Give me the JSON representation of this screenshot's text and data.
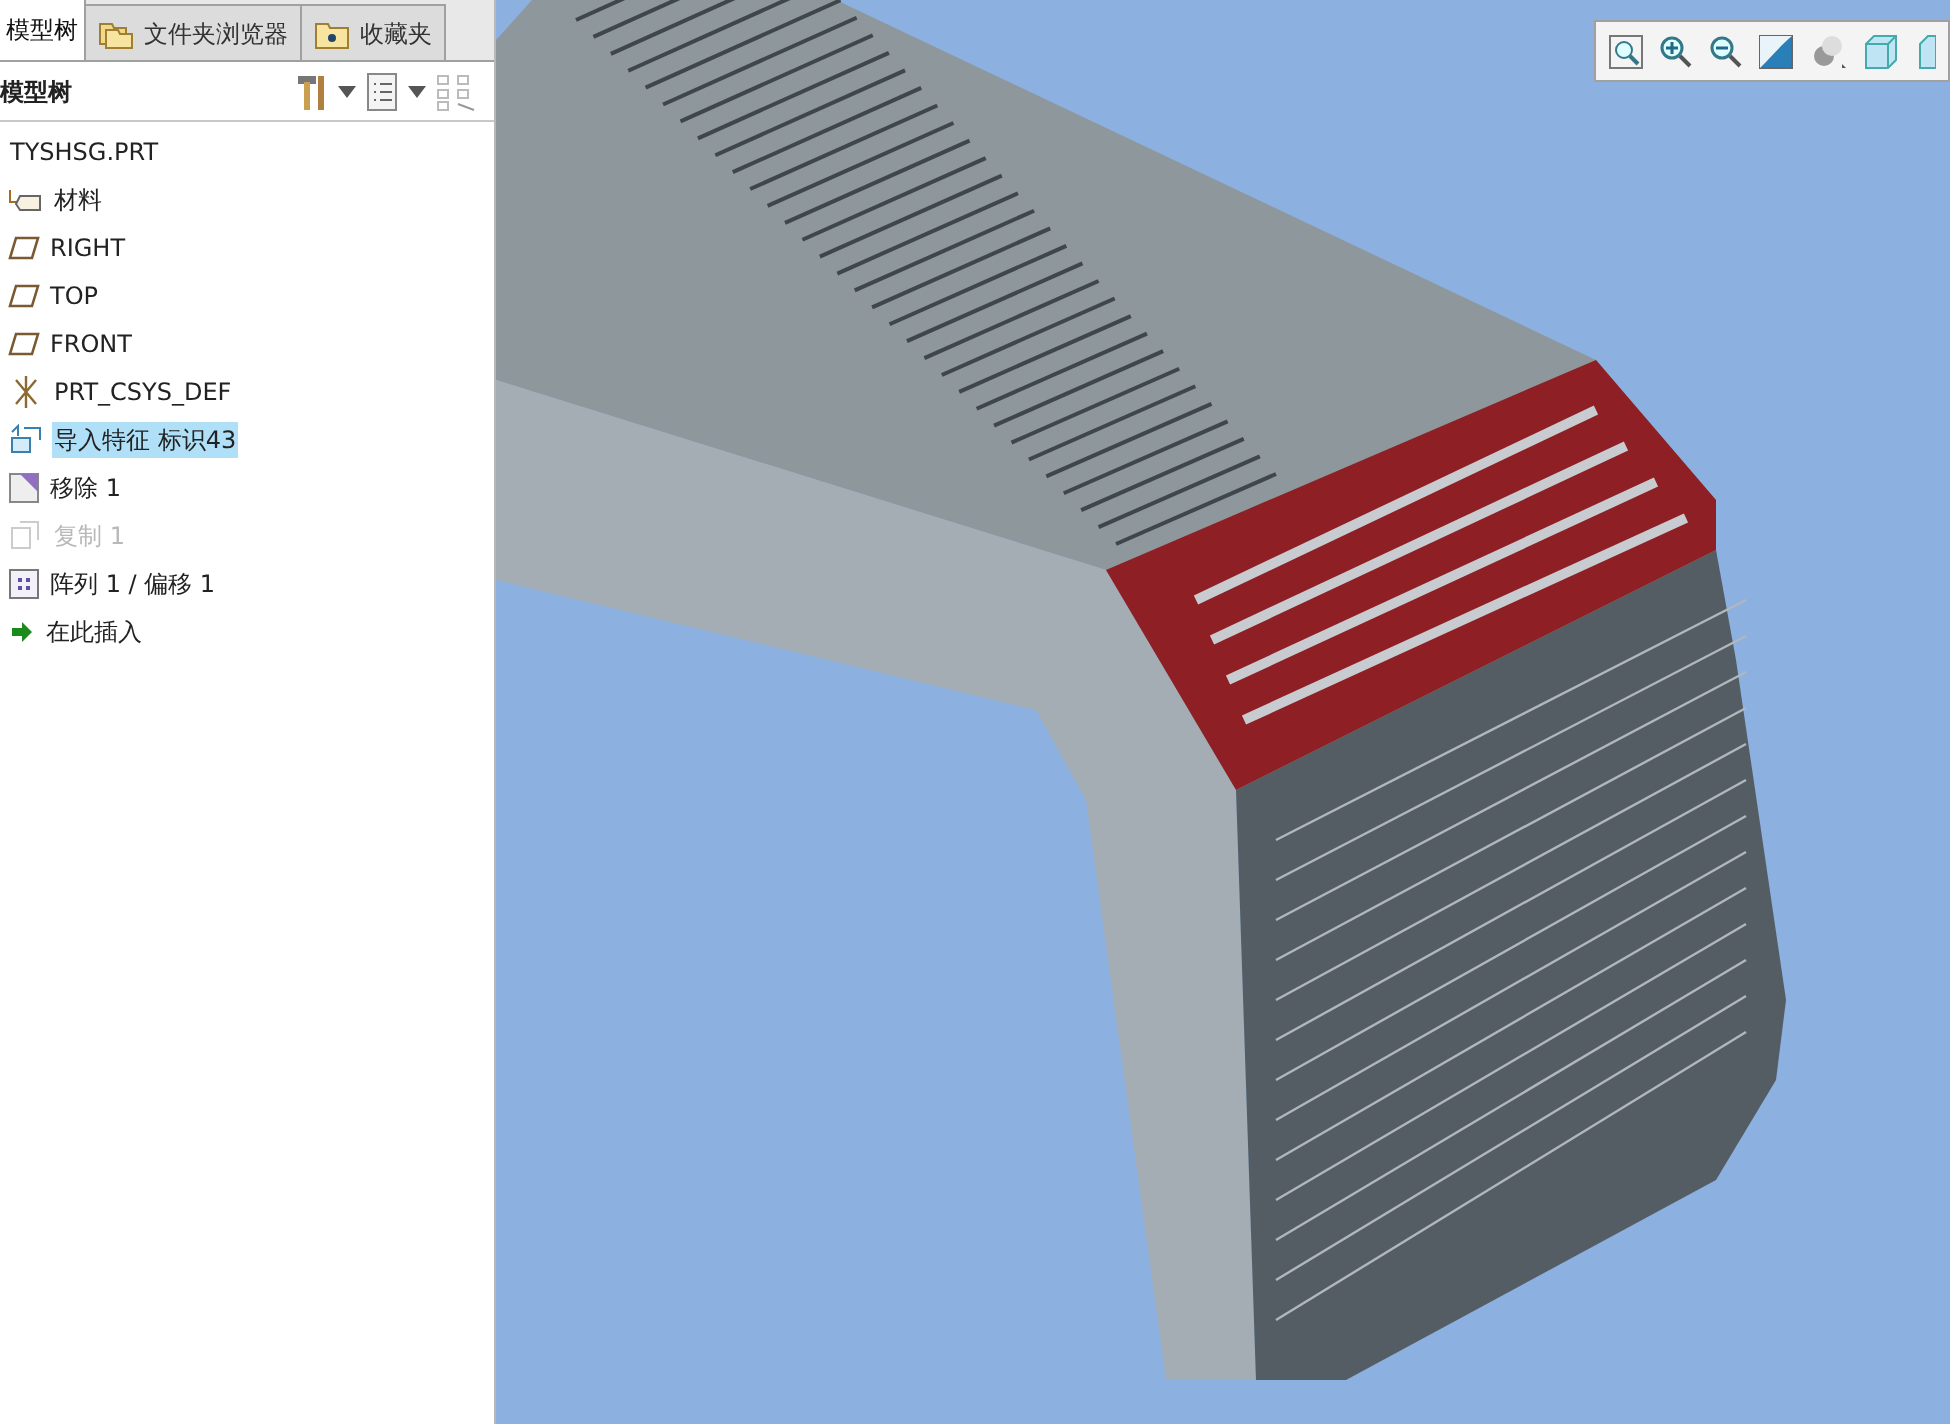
{
  "tabs": [
    {
      "label": "模型树",
      "kind": "tree",
      "selected": true
    },
    {
      "label": "文件夹浏览器",
      "kind": "folders",
      "selected": false
    },
    {
      "label": "收藏夹",
      "kind": "favorites",
      "selected": false
    }
  ],
  "panel": {
    "title": "模型树"
  },
  "tree": {
    "items": [
      {
        "label": "TYSHSG.PRT",
        "kind": "part",
        "selected": false,
        "disabled": false
      },
      {
        "label": "材料",
        "kind": "material",
        "selected": false,
        "disabled": false
      },
      {
        "label": "RIGHT",
        "kind": "plane",
        "selected": false,
        "disabled": false
      },
      {
        "label": "TOP",
        "kind": "plane",
        "selected": false,
        "disabled": false
      },
      {
        "label": "FRONT",
        "kind": "plane",
        "selected": false,
        "disabled": false
      },
      {
        "label": "PRT_CSYS_DEF",
        "kind": "csys",
        "selected": false,
        "disabled": false
      },
      {
        "label": "导入特征 标识43",
        "kind": "import",
        "selected": true,
        "disabled": false
      },
      {
        "label": "移除 1",
        "kind": "remove",
        "selected": false,
        "disabled": false
      },
      {
        "label": "复制 1",
        "kind": "copy",
        "selected": false,
        "disabled": true
      },
      {
        "label": "阵列 1 / 偏移 1",
        "kind": "pattern",
        "selected": false,
        "disabled": false
      },
      {
        "label": "在此插入",
        "kind": "insert",
        "selected": false,
        "disabled": false
      }
    ]
  }
}
